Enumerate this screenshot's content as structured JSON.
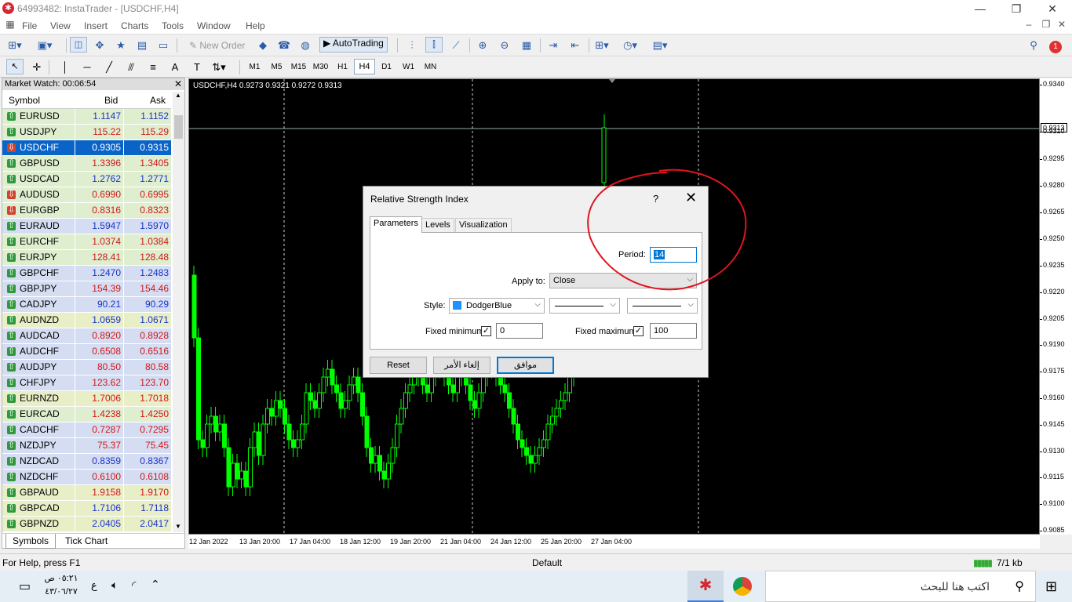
{
  "window": {
    "title": "64993482: InstaTrader - [USDCHF,H4]",
    "minimize": "—",
    "maximize": "❐",
    "close": "✕"
  },
  "menu": [
    "File",
    "View",
    "Insert",
    "Charts",
    "Tools",
    "Window",
    "Help"
  ],
  "toolbar": {
    "new_order": "New Order",
    "auto_trading": "AutoTrading",
    "notify_count": "1"
  },
  "timeframes": [
    "M1",
    "M5",
    "M15",
    "M30",
    "H1",
    "H4",
    "D1",
    "W1",
    "MN"
  ],
  "active_timeframe": "H4",
  "market_watch": {
    "title": "Market Watch: 00:06:54",
    "headers": {
      "symbol": "Symbol",
      "bid": "Bid",
      "ask": "Ask"
    },
    "rows": [
      {
        "symbol": "EURUSD",
        "bid": "1.1147",
        "ask": "1.1152",
        "dir": "up",
        "bg": "g",
        "c": "vblue"
      },
      {
        "symbol": "USDJPY",
        "bid": "115.22",
        "ask": "115.29",
        "dir": "up",
        "bg": "g",
        "c": "vred"
      },
      {
        "symbol": "USDCHF",
        "bid": "0.9305",
        "ask": "0.9315",
        "dir": "dn",
        "bg": "sel",
        "c": "vblue"
      },
      {
        "symbol": "GBPUSD",
        "bid": "1.3396",
        "ask": "1.3405",
        "dir": "up",
        "bg": "g",
        "c": "vred"
      },
      {
        "symbol": "USDCAD",
        "bid": "1.2762",
        "ask": "1.2771",
        "dir": "up",
        "bg": "g",
        "c": "vblue"
      },
      {
        "symbol": "AUDUSD",
        "bid": "0.6990",
        "ask": "0.6995",
        "dir": "dn",
        "bg": "g",
        "c": "vred"
      },
      {
        "symbol": "EURGBP",
        "bid": "0.8316",
        "ask": "0.8323",
        "dir": "dn",
        "bg": "g",
        "c": "vred"
      },
      {
        "symbol": "EURAUD",
        "bid": "1.5947",
        "ask": "1.5970",
        "dir": "up",
        "bg": "b",
        "c": "vblue"
      },
      {
        "symbol": "EURCHF",
        "bid": "1.0374",
        "ask": "1.0384",
        "dir": "up",
        "bg": "g",
        "c": "vred"
      },
      {
        "symbol": "EURJPY",
        "bid": "128.41",
        "ask": "128.48",
        "dir": "up",
        "bg": "g",
        "c": "vred"
      },
      {
        "symbol": "GBPCHF",
        "bid": "1.2470",
        "ask": "1.2483",
        "dir": "up",
        "bg": "b",
        "c": "vblue"
      },
      {
        "symbol": "GBPJPY",
        "bid": "154.39",
        "ask": "154.46",
        "dir": "up",
        "bg": "b",
        "c": "vred"
      },
      {
        "symbol": "CADJPY",
        "bid": "90.21",
        "ask": "90.29",
        "dir": "up",
        "bg": "b",
        "c": "vblue"
      },
      {
        "symbol": "AUDNZD",
        "bid": "1.0659",
        "ask": "1.0671",
        "dir": "up",
        "bg": "y",
        "c": "vblue"
      },
      {
        "symbol": "AUDCAD",
        "bid": "0.8920",
        "ask": "0.8928",
        "dir": "up",
        "bg": "b",
        "c": "vred"
      },
      {
        "symbol": "AUDCHF",
        "bid": "0.6508",
        "ask": "0.6516",
        "dir": "up",
        "bg": "b",
        "c": "vred"
      },
      {
        "symbol": "AUDJPY",
        "bid": "80.50",
        "ask": "80.58",
        "dir": "up",
        "bg": "b",
        "c": "vred"
      },
      {
        "symbol": "CHFJPY",
        "bid": "123.62",
        "ask": "123.70",
        "dir": "up",
        "bg": "b",
        "c": "vred"
      },
      {
        "symbol": "EURNZD",
        "bid": "1.7006",
        "ask": "1.7018",
        "dir": "up",
        "bg": "y",
        "c": "vred"
      },
      {
        "symbol": "EURCAD",
        "bid": "1.4238",
        "ask": "1.4250",
        "dir": "up",
        "bg": "g",
        "c": "vred"
      },
      {
        "symbol": "CADCHF",
        "bid": "0.7287",
        "ask": "0.7295",
        "dir": "up",
        "bg": "b",
        "c": "vred"
      },
      {
        "symbol": "NZDJPY",
        "bid": "75.37",
        "ask": "75.45",
        "dir": "up",
        "bg": "b",
        "c": "vred"
      },
      {
        "symbol": "NZDCAD",
        "bid": "0.8359",
        "ask": "0.8367",
        "dir": "up",
        "bg": "b",
        "c": "vblue"
      },
      {
        "symbol": "NZDCHF",
        "bid": "0.6100",
        "ask": "0.6108",
        "dir": "up",
        "bg": "b",
        "c": "vred"
      },
      {
        "symbol": "GBPAUD",
        "bid": "1.9158",
        "ask": "1.9170",
        "dir": "up",
        "bg": "y",
        "c": "vred"
      },
      {
        "symbol": "GBPCAD",
        "bid": "1.7106",
        "ask": "1.7118",
        "dir": "up",
        "bg": "y",
        "c": "vblue"
      },
      {
        "symbol": "GBPNZD",
        "bid": "2.0405",
        "ask": "2.0417",
        "dir": "up",
        "bg": "y",
        "c": "vblue"
      }
    ],
    "tabs": [
      "Symbols",
      "Tick Chart"
    ]
  },
  "chart": {
    "label": "USDCHF,H4  0.9273 0.9321 0.9272 0.9313",
    "current_price": "0.9313",
    "price_ticks": [
      "0.9340",
      "0.9310",
      "0.9295",
      "0.9280",
      "0.9265",
      "0.9250",
      "0.9235",
      "0.9220",
      "0.9205",
      "0.9190",
      "0.9175",
      "0.9160",
      "0.9145",
      "0.9130",
      "0.9115",
      "0.9100",
      "0.9085"
    ],
    "date_ticks": [
      "12 Jan 2022",
      "13 Jan 20:00",
      "17 Jan 04:00",
      "18 Jan 12:00",
      "19 Jan 20:00",
      "21 Jan 04:00",
      "24 Jan 12:00",
      "25 Jan 20:00",
      "27 Jan 04:00"
    ],
    "bull_color": "#00ff00"
  },
  "dialog": {
    "title": "Relative Strength Index",
    "help": "?",
    "close": "✕",
    "tabs": [
      "Parameters",
      "Levels",
      "Visualization"
    ],
    "period_label": "Period:",
    "period_value": "14",
    "apply_label": "Apply to:",
    "apply_value": "Close",
    "style_label": "Style:",
    "style_color": "DodgerBlue",
    "fixed_min_label": "Fixed minimum",
    "fixed_min_value": "0",
    "fixed_max_label": "Fixed maximum",
    "fixed_max_value": "100",
    "reset": "Reset",
    "cancel": "إلغاء الأمر",
    "ok": "موافق"
  },
  "status": {
    "help": "For Help, press F1",
    "profile": "Default",
    "traffic": "7/1 kb"
  },
  "taskbar": {
    "time": "٠٥:٢١ ص",
    "date": "٤٣/٠٦/٢٧",
    "lang": "ع",
    "search_placeholder": "اكتب هنا للبحث"
  }
}
